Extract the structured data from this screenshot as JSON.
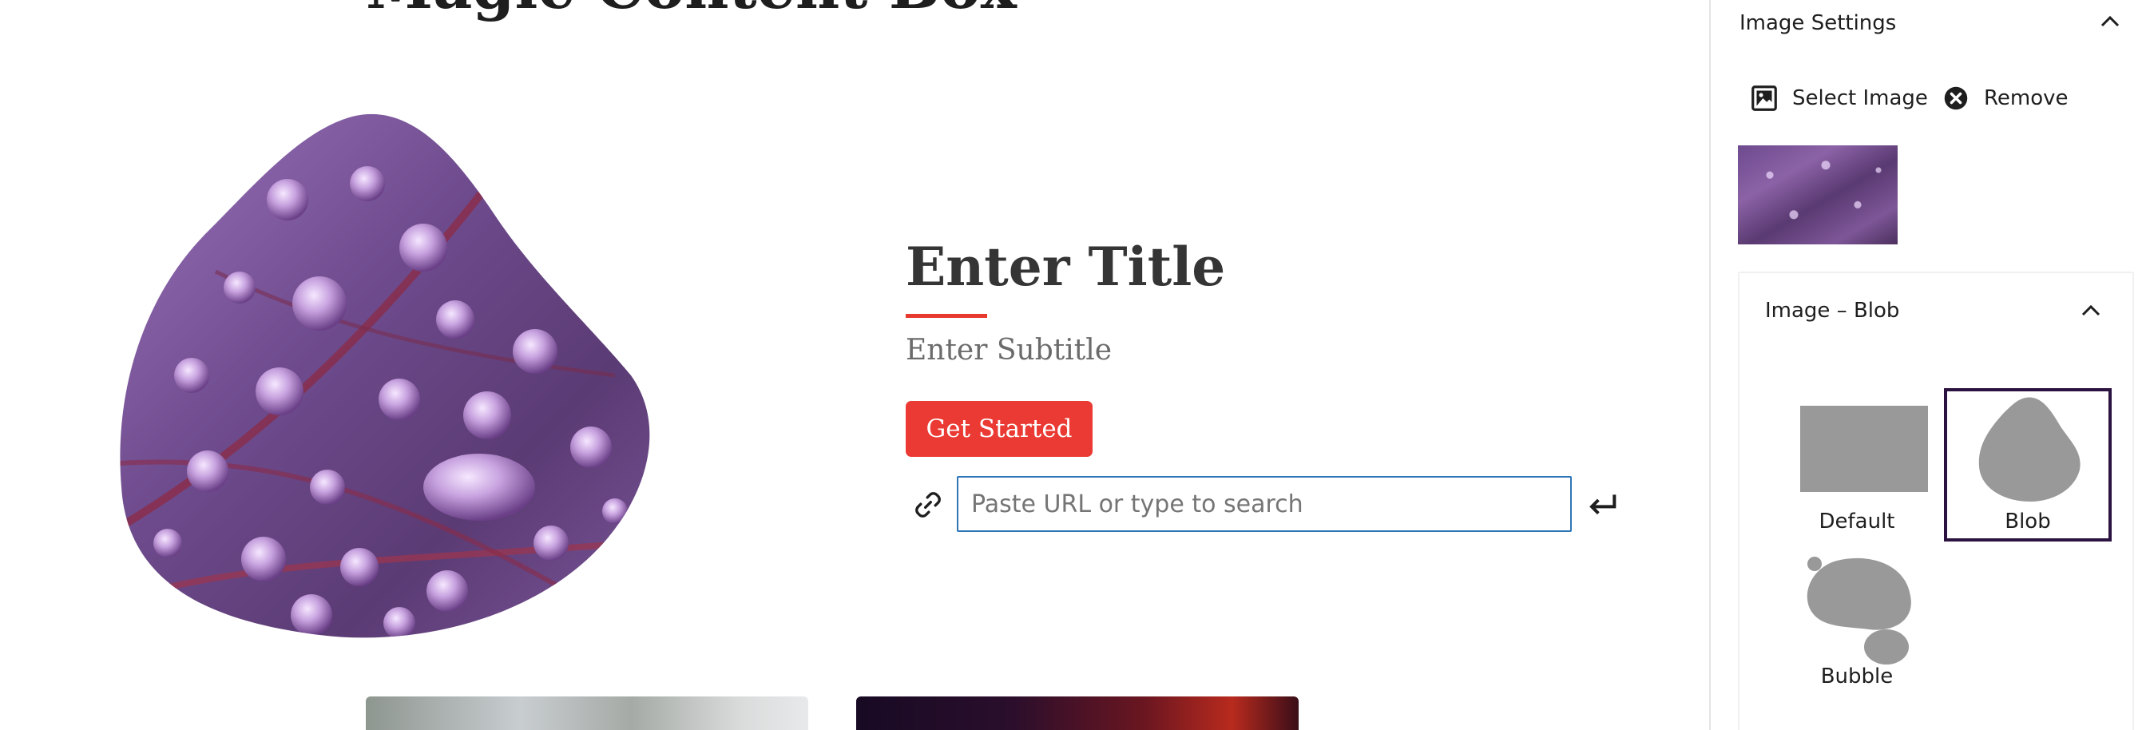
{
  "editor": {
    "post_title": "Magic Content Box",
    "content_box": {
      "title": "Enter Title",
      "subtitle": "Enter Subtitle",
      "button_label": "Get Started",
      "url_input": {
        "value": "",
        "placeholder": "Paste URL or type to search"
      }
    }
  },
  "sidebar": {
    "image_settings": {
      "title": "Image Settings",
      "select_label": "Select Image",
      "remove_label": "Remove"
    },
    "image_style": {
      "title": "Image – Blob",
      "options": [
        {
          "label": "Default",
          "selected": false
        },
        {
          "label": "Blob",
          "selected": true
        },
        {
          "label": "Bubble",
          "selected": false
        }
      ]
    }
  },
  "colors": {
    "accent": "#ea3a33",
    "input_focus": "#2f76b7",
    "selected_border": "#2c1240",
    "shape_gray": "#999999"
  },
  "icons": [
    "link-icon",
    "enter-icon",
    "image-icon",
    "remove-circle-icon",
    "chevron-up-icon"
  ]
}
